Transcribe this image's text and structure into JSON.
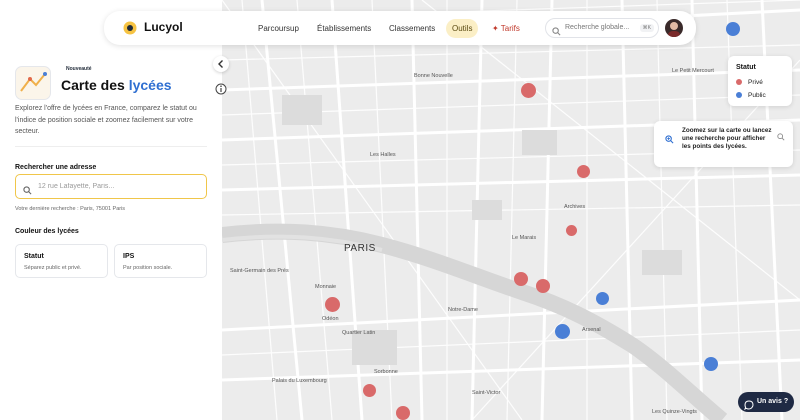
{
  "header": {
    "brand": "Lucyol",
    "nav": [
      {
        "label": "Parcoursup",
        "active": false
      },
      {
        "label": "Établissements",
        "active": false
      },
      {
        "label": "Classements",
        "active": false
      },
      {
        "label": "Outils",
        "active": true
      },
      {
        "label": "Tarifs",
        "active": false
      }
    ],
    "search_placeholder": "Recherche globale...",
    "search_shortcut": "⌘K"
  },
  "panel": {
    "badge": "Nouveauté",
    "title_prefix": "Carte des",
    "title_accent": "lycées",
    "description": "Explorez l'offre de lycées en France, comparez le statut ou l'indice de position sociale et zoomez facilement sur votre secteur.",
    "address_label": "Rechercher une adresse",
    "address_placeholder": "12 rue Lafayette, Paris...",
    "last_search": "Votre dernière recherche : Paris, 75001 Paris",
    "color_label": "Couleur des lycées",
    "cards": [
      {
        "title": "Statut",
        "subtitle": "Séparez public et privé."
      },
      {
        "title": "IPS",
        "subtitle": "Par position sociale."
      }
    ]
  },
  "legend": {
    "title": "Statut",
    "items": [
      {
        "label": "Privé",
        "color": "#d96a6a"
      },
      {
        "label": "Public",
        "color": "#4a7fd6"
      }
    ]
  },
  "tooltip": {
    "text": "Zoomez sur la carte ou lancez une recherche pour afficher les points des lycées."
  },
  "feedback": {
    "label": "Un avis ?"
  },
  "map": {
    "city_label": "PARIS",
    "labels": [
      "Bonne Nouvelle",
      "Le Petit Mercourt",
      "Les Halles",
      "Le Marais",
      "Archives",
      "Saint-Germain des Prés",
      "Monnaie",
      "Notre-Dame",
      "Odéon",
      "Quartier Latin",
      "Arsenal",
      "Sorbonne",
      "Palais du Luxembourg",
      "Saint-Victor",
      "Les Quinze-Vingts"
    ],
    "colors": {
      "private": "#d96a6a",
      "public": "#4a7fd6"
    }
  }
}
